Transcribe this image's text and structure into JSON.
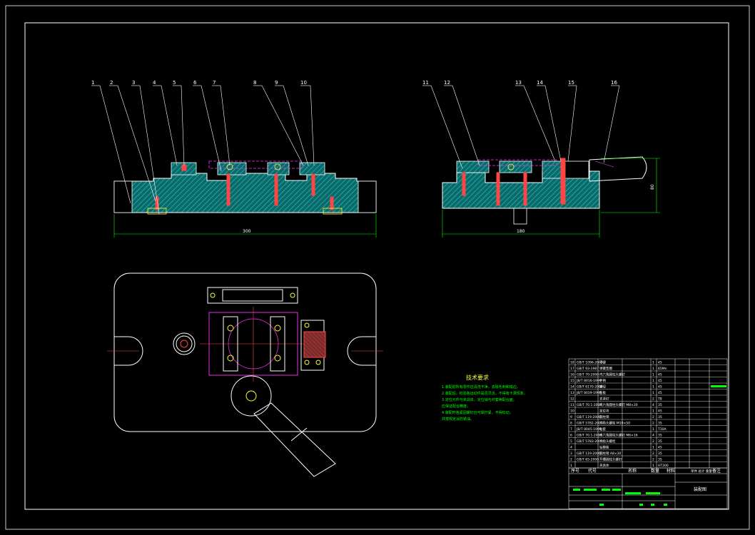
{
  "balloons_left": [
    "1",
    "2",
    "3",
    "4",
    "5",
    "6",
    "7",
    "8",
    "9",
    "10"
  ],
  "balloons_right": [
    "11",
    "12",
    "13",
    "14",
    "15",
    "16"
  ],
  "dimensions": {
    "front_width": "300",
    "side_width": "180",
    "side_height": "80"
  },
  "technical_requirements": {
    "title": "技术要求",
    "lines": [
      "1.装配前所有零件应清洗干净，去除毛刺和锐边。",
      "2.装配后，检验各运动件是否灵活，不得有卡滞现象。",
      "3.定位元件与夹具体，定位销与衬套等配合面，",
      "  应保证配合精度。",
      "4.装配时各紧固螺钉应可靠拧紧，不得松动，",
      "  并按规定涂防锈油。"
    ]
  },
  "bom_rows": [
    {
      "no": "18",
      "code": "GB/T 1096-2003",
      "name": "平键",
      "qty": "1",
      "mat": "45"
    },
    {
      "no": "17",
      "code": "GB/T 93-1987",
      "name": "弹簧垫圈",
      "qty": "1",
      "mat": "65Mn"
    },
    {
      "no": "16",
      "code": "GB/T 70-2000",
      "name": "内六角圆柱头螺钉",
      "qty": "1",
      "mat": "45"
    },
    {
      "no": "15",
      "code": "JB/T 8016-1999",
      "name": "手柄",
      "qty": "1",
      "mat": "45"
    },
    {
      "no": "14",
      "code": "GB/T 6170-2000",
      "name": "螺母",
      "qty": "1",
      "mat": "45"
    },
    {
      "no": "13",
      "code": "JB/T 8019-1999",
      "name": "压板",
      "qty": "1",
      "mat": "45"
    },
    {
      "no": "12",
      "code": "",
      "name": "支承钉",
      "qty": "2",
      "mat": "T8"
    },
    {
      "no": "11",
      "code": "GB/T 70.1-2000",
      "name": "内六角圆柱头螺钉 M8×20",
      "qty": "4",
      "mat": "35"
    },
    {
      "no": "10",
      "code": "",
      "name": "定位块",
      "qty": "1",
      "mat": "45"
    },
    {
      "no": "9",
      "code": "GB/T 119-2000",
      "name": "圆柱销",
      "qty": "2",
      "mat": "35"
    },
    {
      "no": "8",
      "code": "GB/T 5782-2000",
      "name": "六角头螺栓 M10×50",
      "qty": "2",
      "mat": "35"
    },
    {
      "no": "7",
      "code": "JB/T 8045-1999",
      "name": "钻套",
      "qty": "1",
      "mat": "T10A"
    },
    {
      "no": "6",
      "code": "GB/T 70.1-2000",
      "name": "内六角圆柱头螺钉 M6×16",
      "qty": "4",
      "mat": "35"
    },
    {
      "no": "5",
      "code": "GB/T 5783-2000",
      "name": "六角头螺栓",
      "qty": "2",
      "mat": "35"
    },
    {
      "no": "4",
      "code": "",
      "name": "钻模板",
      "qty": "1",
      "mat": "45"
    },
    {
      "no": "3",
      "code": "GB/T 119-2000",
      "name": "圆柱销 A8×30",
      "qty": "2",
      "mat": "35"
    },
    {
      "no": "2",
      "code": "GB/T 65-2000",
      "name": "开槽圆柱头螺钉",
      "qty": "2",
      "mat": "35"
    },
    {
      "no": "1",
      "code": "",
      "name": "夹具体",
      "qty": "1",
      "mat": "HT200"
    }
  ],
  "bom_header": {
    "no": "序号",
    "code": "代号",
    "name": "名称",
    "qty": "数量",
    "mat": "材料",
    "weight": "单件 总计 重量",
    "remark": "备注"
  },
  "title_block": {
    "drawing_name": "装配图"
  },
  "colors": {
    "outline": "#ffffff",
    "hatch": "#00aaaa",
    "phantom": "#ff00ff",
    "dimension": "#00ff00",
    "text": "#00ff00"
  }
}
